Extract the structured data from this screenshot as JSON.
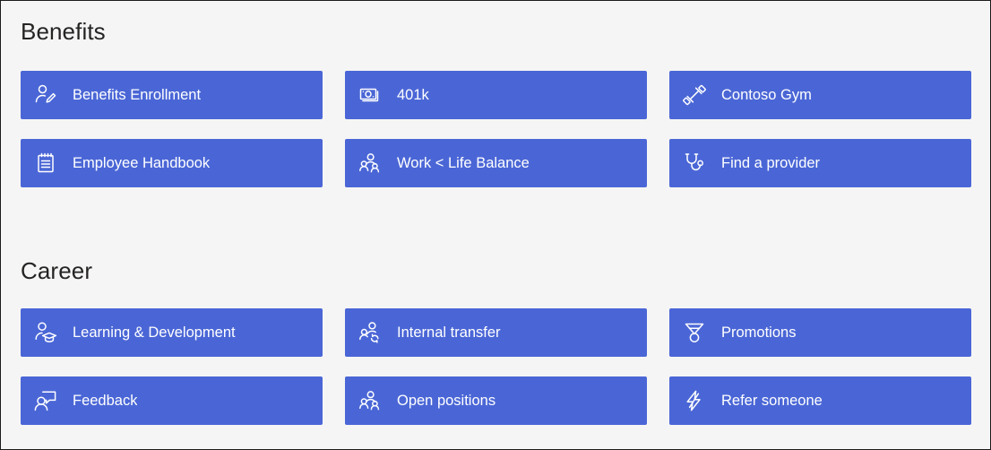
{
  "page": {
    "background_color": "#f5f5f5",
    "accent_color": "#4a66d6",
    "text_color_on_accent": "#ffffff",
    "heading_color": "#252423"
  },
  "sections": [
    {
      "id": "benefits",
      "title": "Benefits",
      "tiles": [
        {
          "label": "Benefits Enrollment",
          "icon": "person-edit-icon"
        },
        {
          "label": "401k",
          "icon": "money-bill-icon"
        },
        {
          "label": "Contoso Gym",
          "icon": "dumbbell-icon"
        },
        {
          "label": "Employee Handbook",
          "icon": "notepad-icon"
        },
        {
          "label": "Work < Life Balance",
          "icon": "people-group-icon"
        },
        {
          "label": "Find a provider",
          "icon": "stethoscope-icon"
        }
      ]
    },
    {
      "id": "career",
      "title": "Career",
      "tiles": [
        {
          "label": "Learning & Development",
          "icon": "person-graduation-cap-icon"
        },
        {
          "label": "Internal transfer",
          "icon": "people-sync-icon"
        },
        {
          "label": "Promotions",
          "icon": "medal-icon"
        },
        {
          "label": "Feedback",
          "icon": "person-feedback-icon"
        },
        {
          "label": "Open positions",
          "icon": "people-group-icon"
        },
        {
          "label": "Refer someone",
          "icon": "lightning-bolt-icon"
        }
      ]
    }
  ]
}
